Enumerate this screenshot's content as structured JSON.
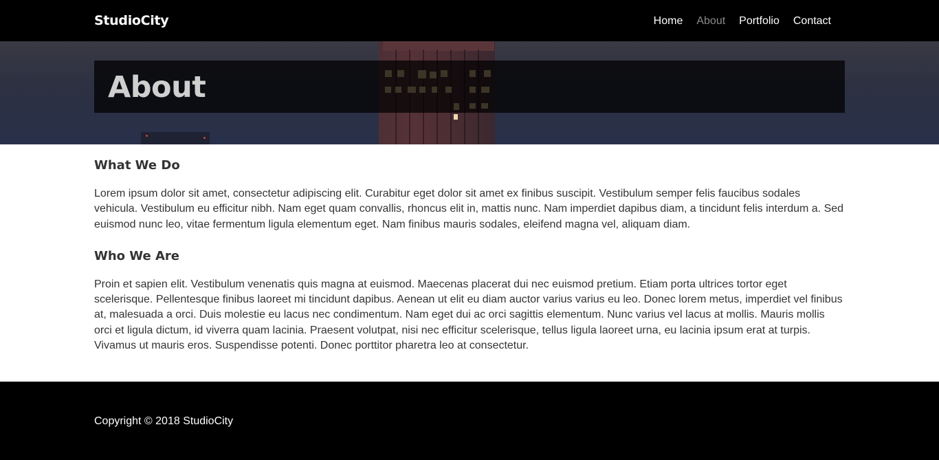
{
  "brand": "StudioCity",
  "nav": {
    "items": [
      {
        "label": "Home",
        "active": false
      },
      {
        "label": "About",
        "active": true
      },
      {
        "label": "Portfolio",
        "active": false
      },
      {
        "label": "Contact",
        "active": false
      }
    ]
  },
  "hero": {
    "title": "About"
  },
  "main": {
    "sections": [
      {
        "heading": "What We Do",
        "body": "Lorem ipsum dolor sit amet, consectetur adipiscing elit. Curabitur eget dolor sit amet ex finibus suscipit. Vestibulum semper felis faucibus sodales vehicula. Vestibulum eu efficitur nibh. Nam eget quam convallis, rhoncus elit in, mattis nunc. Nam imperdiet dapibus diam, a tincidunt felis interdum a. Sed euismod nunc leo, vitae fermentum ligula elementum eget. Nam finibus mauris sodales, eleifend magna vel, aliquam diam."
      },
      {
        "heading": "Who We Are",
        "body": "Proin et sapien elit. Vestibulum venenatis quis magna at euismod. Maecenas placerat dui nec euismod pretium. Etiam porta ultrices tortor eget scelerisque. Pellentesque finibus laoreet mi tincidunt dapibus. Aenean ut elit eu diam auctor varius varius eu leo. Donec lorem metus, imperdiet vel finibus at, malesuada a orci. Duis molestie eu lacus nec condimentum. Nam eget dui ac orci sagittis elementum. Nunc varius vel lacus at mollis. Mauris mollis orci et ligula dictum, id viverra quam lacinia. Praesent volutpat, nisi nec efficitur scelerisque, tellus ligula laoreet urna, eu lacinia ipsum erat at turpis. Vivamus ut mauris eros. Suspendisse potenti. Donec porttitor pharetra leo at consectetur."
      }
    ]
  },
  "footer": {
    "copyright": "Copyright © 2018 StudioCity"
  },
  "colors": {
    "navbar_bg": "#000000",
    "nav_active": "#8a8a8a",
    "text": "#333333",
    "footer_bg": "#000000"
  }
}
